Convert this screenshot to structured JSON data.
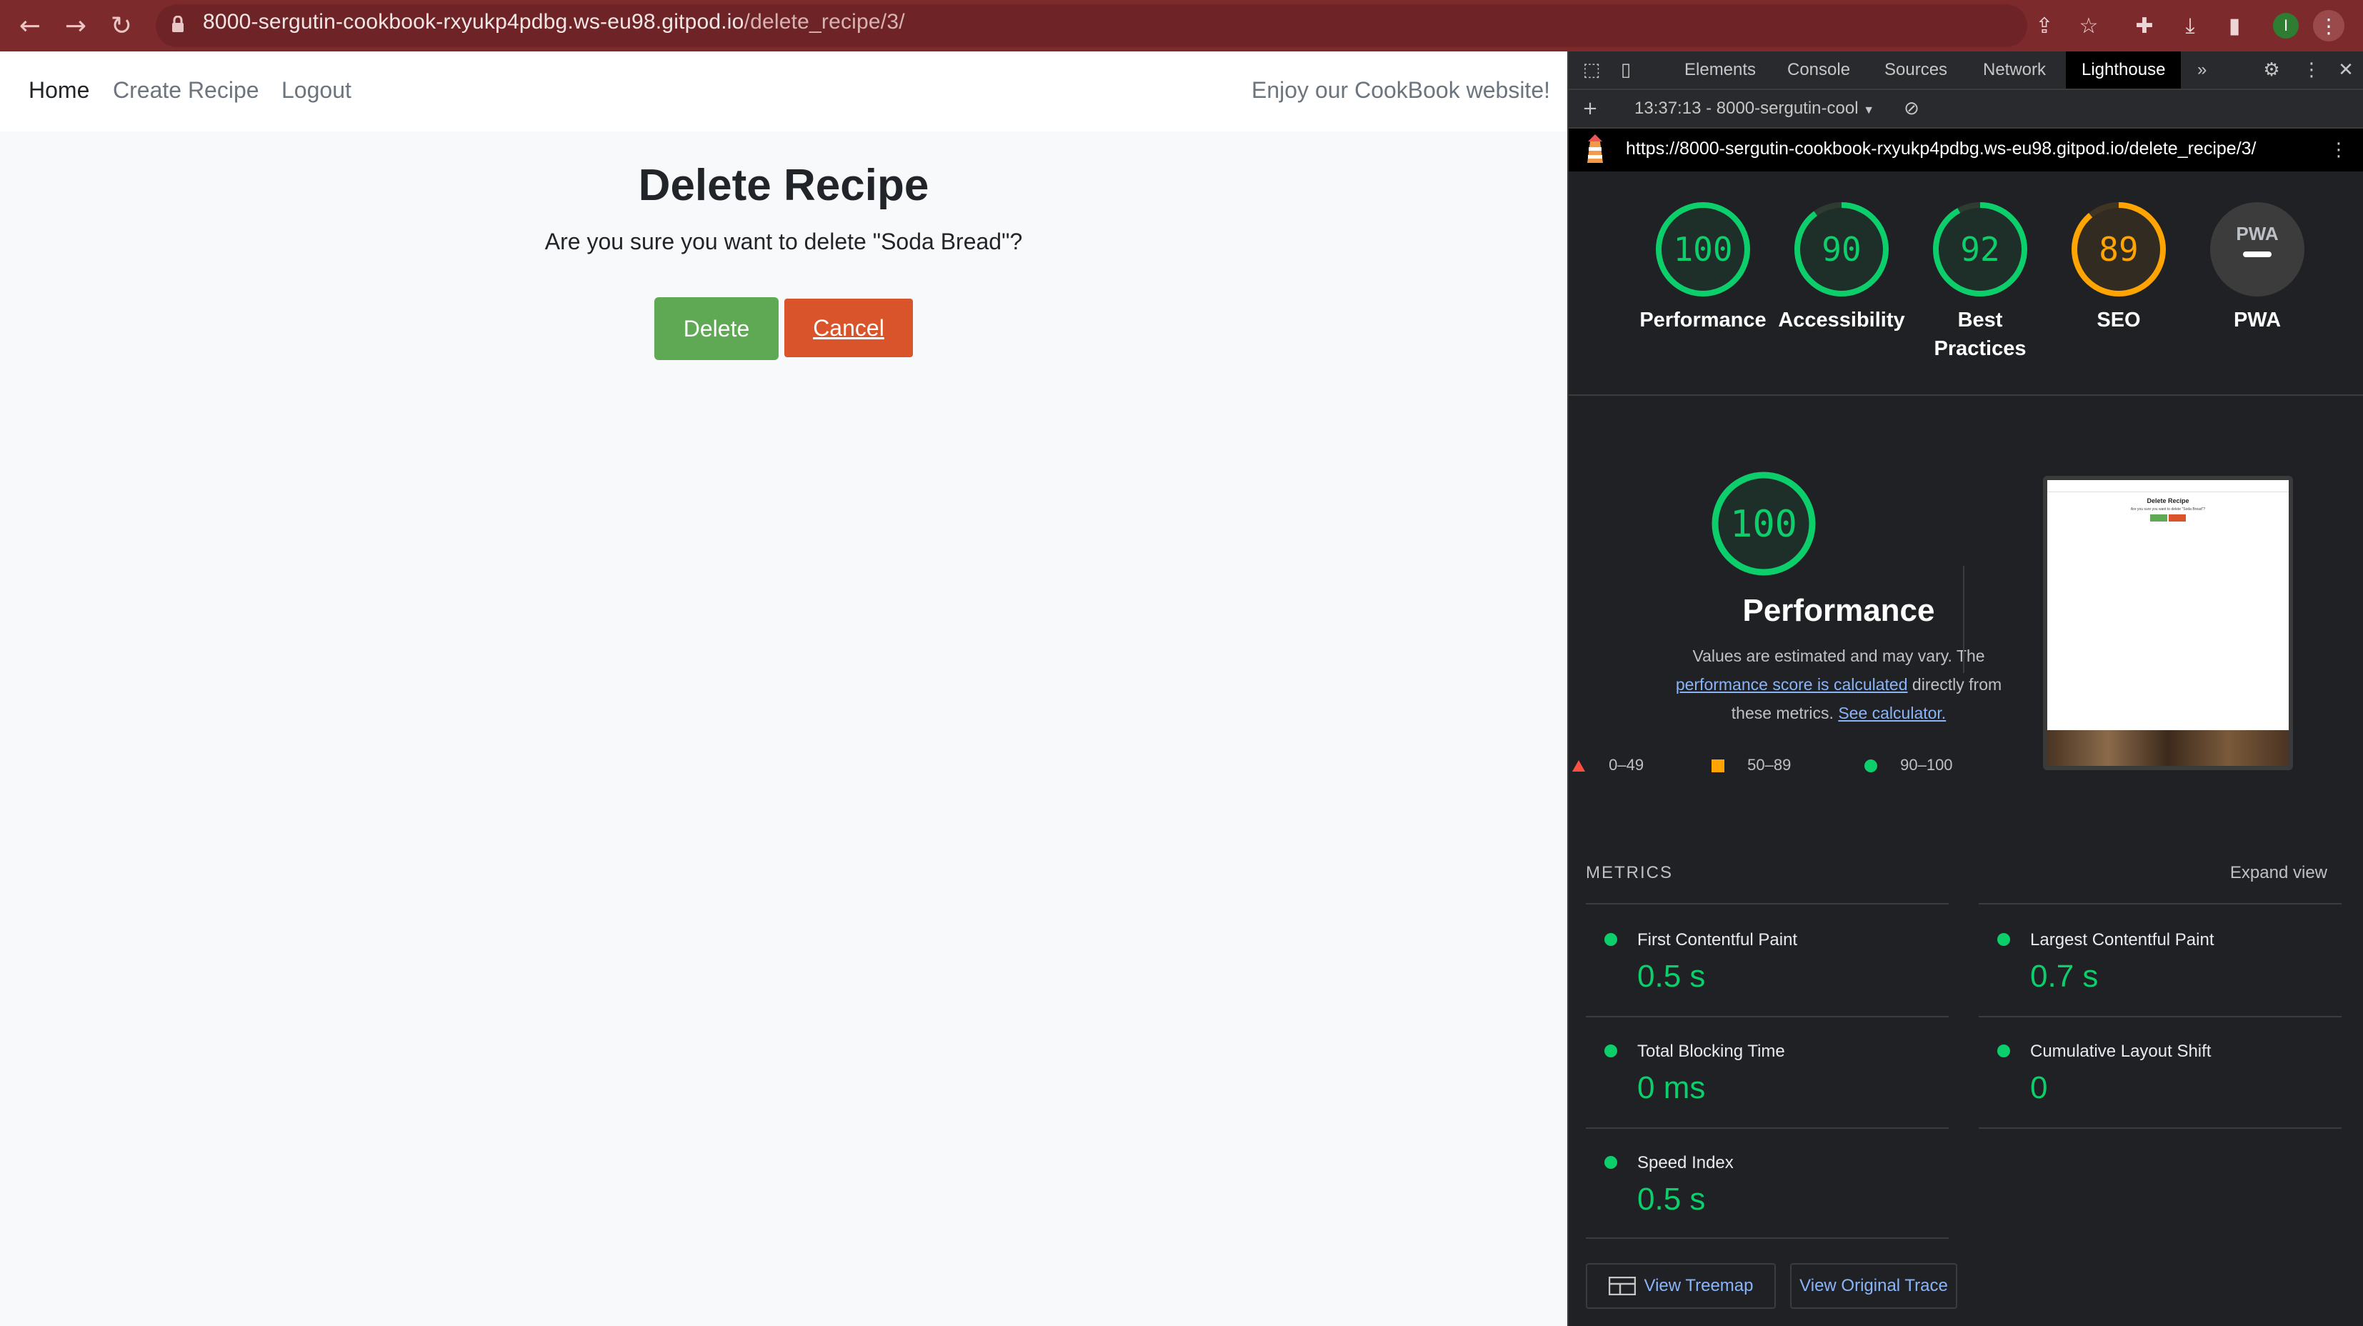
{
  "browser": {
    "url_host": "8000-sergutin-cookbook-rxyukp4pdbg.ws-eu98.gitpod.io",
    "url_path": "/delete_recipe/3/",
    "back_icon": "arrow-left-icon",
    "forward_icon": "arrow-right-icon",
    "reload_icon": "reload-icon",
    "profile_initial": "I"
  },
  "page": {
    "nav": {
      "home": "Home",
      "create": "Create Recipe",
      "logout": "Logout",
      "tagline": "Enjoy our CookBook website!"
    },
    "title": "Delete Recipe",
    "question": "Are you sure you want to delete \"Soda Bread\"?",
    "delete_label": "Delete",
    "cancel_label": "Cancel"
  },
  "devtools": {
    "tabs": [
      "Elements",
      "Console",
      "Sources",
      "Network",
      "Lighthouse"
    ],
    "more_tabs": "»",
    "report_select": "13:37:13 - 8000-sergutin-cool",
    "report_url": "https://8000-sergutin-cookbook-rxyukp4pdbg.ws-eu98.gitpod.io/delete_recipe/3/",
    "scores": [
      {
        "label_1": "Performance",
        "label_2": "",
        "value": "100",
        "percent": 100,
        "color": "#0cce6b"
      },
      {
        "label_1": "Accessibility",
        "label_2": "",
        "value": "90",
        "percent": 90,
        "color": "#0cce6b"
      },
      {
        "label_1": "Best",
        "label_2": "Practices",
        "value": "92",
        "percent": 92,
        "color": "#0cce6b"
      },
      {
        "label_1": "SEO",
        "label_2": "",
        "value": "89",
        "percent": 89,
        "color": "#ffa400"
      },
      {
        "label_1": "PWA",
        "label_2": "",
        "value": "PWA",
        "percent": 0,
        "color": "#9aa0a6"
      }
    ],
    "perf": {
      "score": "100",
      "title": "Performance",
      "desc_1": "Values are estimated and may vary. The",
      "link_1": "performance score is calculated",
      "desc_2": "directly from",
      "desc_3": "these metrics.",
      "link_2": "See calculator."
    },
    "legend": [
      {
        "range": "0–49",
        "shape": "triangle",
        "color": "#ff4e42"
      },
      {
        "range": "50–89",
        "shape": "square",
        "color": "#ffa400"
      },
      {
        "range": "90–100",
        "shape": "circle",
        "color": "#0cce6b"
      }
    ],
    "thumb": {
      "title": "Delete Recipe",
      "text": "Are you sure you want to delete \"Soda Bread\"?"
    },
    "metrics_title": "METRICS",
    "expand_view": "Expand view",
    "metrics": [
      {
        "label": "First Contentful Paint",
        "value": "0.5 s"
      },
      {
        "label": "Largest Contentful Paint",
        "value": "0.7 s"
      },
      {
        "label": "Total Blocking Time",
        "value": "0 ms"
      },
      {
        "label": "Cumulative Layout Shift",
        "value": "0"
      },
      {
        "label": "Speed Index",
        "value": "0.5 s"
      }
    ],
    "view_treemap": "View Treemap",
    "view_trace": "View Original Trace"
  }
}
